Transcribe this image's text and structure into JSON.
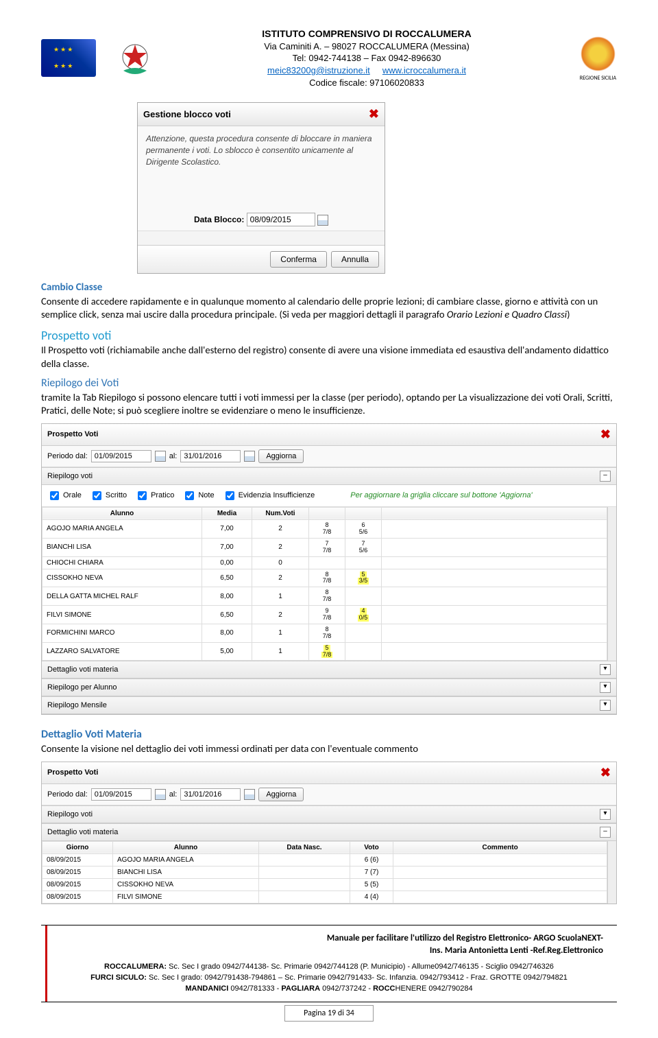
{
  "header": {
    "title": "ISTITUTO COMPRENSIVO DI ROCCALUMERA",
    "addr": "Via Caminiti A. – 98027 ROCCALUMERA (Messina)",
    "tel": "Tel: 0942-744138 – Fax 0942-896630",
    "email": "meic83200g@istruzione.it",
    "site": "www.icroccalumera.it",
    "cf": "Codice fiscale: 97106020833",
    "regione": "REGIONE SICILIA"
  },
  "dialog": {
    "title": "Gestione blocco voti",
    "body": "Attenzione, questa procedura consente di bloccare in maniera permanente i voti. Lo sblocco è consentito unicamente al Dirigente Scolastico.",
    "field_label": "Data Blocco:",
    "field_value": "08/09/2015",
    "confirm": "Conferma",
    "cancel": "Annulla"
  },
  "sections": {
    "cambio_title": "Cambio Classe",
    "cambio_body": "Consente di accedere rapidamente e in qualunque momento al calendario delle proprie lezioni; di cambiare classe, giorno e attività con un semplice click, senza mai uscire dalla procedura principale. (Si veda per maggiori dettagli il paragrafo ",
    "cambio_ital": "Orario Lezioni e Quadro Classi",
    "prospetto_title": "Prospetto voti",
    "prospetto_body": "Il Prospetto voti (richiamabile anche dall'esterno del registro) consente di avere una visione immediata ed esaustiva dell'andamento didattico della classe.",
    "riepilogo_title": "Riepilogo dei Voti",
    "riepilogo_body": "tramite la Tab Riepilogo si possono elencare tutti i voti immessi per la classe (per periodo), optando per  La visualizzazione dei voti Orali, Scritti, Pratici, delle Note; si può scegliere inoltre se evidenziare o meno le insufficienze.",
    "dettaglio_title": "Dettaglio Voti Materia",
    "dettaglio_body": "Consente la visione nel dettaglio dei voti immessi ordinati per data con l'eventuale commento"
  },
  "window1": {
    "title": "Prospetto Voti",
    "periodo_lbl": "Periodo dal:",
    "periodo_from": "01/09/2015",
    "periodo_to_lbl": "al:",
    "periodo_to": "31/01/2016",
    "aggiorna": "Aggiorna",
    "sec_riepilogo": "Riepilogo voti",
    "sec_dett_materia": "Dettaglio voti materia",
    "sec_riep_alunno": "Riepilogo per Alunno",
    "sec_riep_mensile": "Riepilogo Mensile",
    "hint": "Per aggiornare la griglia cliccare sul bottone 'Aggiorna'",
    "filters": {
      "orale": "Orale",
      "scritto": "Scritto",
      "pratico": "Pratico",
      "note": "Note",
      "evidenzia": "Evidenzia Insufficienze"
    },
    "cols": {
      "alunno": "Alunno",
      "media": "Media",
      "numvoti": "Num.Voti"
    },
    "rows": [
      {
        "n": "AGOJO MARIA ANGELA",
        "m": "7,00",
        "nv": "2",
        "v": "8\n7/8",
        "v2": "6\n5/6"
      },
      {
        "n": "BIANCHI LISA",
        "m": "7,00",
        "nv": "2",
        "v": "7\n7/8",
        "v2": "7\n5/6"
      },
      {
        "n": "CHIOCHI CHIARA",
        "m": "0,00",
        "nv": "0",
        "v": "",
        "v2": ""
      },
      {
        "n": "CISSOKHO NEVA",
        "m": "6,50",
        "nv": "2",
        "v": "8\n7/8",
        "v2": "5\n3/5",
        "hl2": true
      },
      {
        "n": "DELLA GATTA MICHEL RALF",
        "m": "8,00",
        "nv": "1",
        "v": "8\n7/8",
        "v2": ""
      },
      {
        "n": "FILVI SIMONE",
        "m": "6,50",
        "nv": "2",
        "v": "9\n7/8",
        "v2": "4\n0/5",
        "hl2": true
      },
      {
        "n": "FORMICHINI MARCO",
        "m": "8,00",
        "nv": "1",
        "v": "8\n7/8",
        "v2": ""
      },
      {
        "n": "LAZZARO SALVATORE",
        "m": "5,00",
        "nv": "1",
        "v": "5\n7/8",
        "v2": "",
        "hl1": true
      }
    ]
  },
  "window2": {
    "title": "Prospetto Voti",
    "periodo_lbl": "Periodo dal:",
    "periodo_from": "01/09/2015",
    "periodo_to_lbl": "al:",
    "periodo_to": "31/01/2016",
    "aggiorna": "Aggiorna",
    "sec_riepilogo": "Riepilogo voti",
    "sec_dett_materia": "Dettaglio voti materia",
    "cols": {
      "giorno": "Giorno",
      "alunno": "Alunno",
      "data": "Data Nasc.",
      "voto": "Voto",
      "commento": "Commento"
    },
    "rows": [
      {
        "g": "08/09/2015",
        "a": "AGOJO MARIA ANGELA",
        "d": "",
        "v": "6 (6)"
      },
      {
        "g": "08/09/2015",
        "a": "BIANCHI LISA",
        "d": "",
        "v": "7 (7)"
      },
      {
        "g": "08/09/2015",
        "a": "CISSOKHO NEVA",
        "d": "",
        "v": "5 (5)"
      },
      {
        "g": "08/09/2015",
        "a": "FILVI SIMONE",
        "d": "",
        "v": "4 (4)"
      }
    ]
  },
  "footer": {
    "r1": "Manuale  per facilitare l'utilizzo del Registro Elettronico- ARGO ScuolaNEXT-",
    "r2": "Ins. Maria Antonietta Lenti -Ref.Reg.Elettronico",
    "l1": "ROCCALUMERA: Sc. Sec I grado  0942/744138- Sc. Primarie 0942/744128 (P. Municipio) - Allume0942/746135 - Sciglio 0942/746326",
    "l2": "FURCI SICULO: Sc. Sec I grado: 0942/791438-794861 – Sc. Primarie 0942/791433-  Sc. Infanzia. 0942/793412 - Fraz. GROTTE  0942/794821",
    "l3": "MANDANICI  0942/781333 - PAGLIARA  0942/737242 - ROCCHENERE 0942/790284",
    "page": "Pagina 19 di 34"
  }
}
